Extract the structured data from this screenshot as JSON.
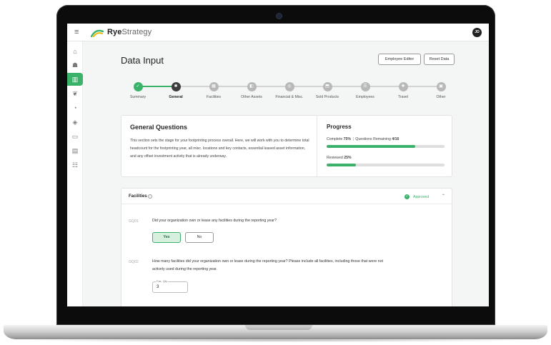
{
  "app": {
    "brand_bold": "Rye",
    "brand_light": "Strategy",
    "user_initials": "JD"
  },
  "header": {
    "title": "Data Input",
    "buttons": [
      "Employee Editor",
      "Reset Data"
    ]
  },
  "sidebar": {
    "items": [
      {
        "icon": "home-icon",
        "glyph": "⌂",
        "active": false
      },
      {
        "icon": "user-icon",
        "glyph": "☗",
        "active": false
      },
      {
        "icon": "bar-chart-icon",
        "glyph": "▥",
        "active": true
      },
      {
        "icon": "leaf-icon",
        "glyph": "❦",
        "active": false
      },
      {
        "icon": "pie-chart-icon",
        "glyph": "◔",
        "active": false
      },
      {
        "icon": "layers-icon",
        "glyph": "◈",
        "active": false
      },
      {
        "icon": "folder-icon",
        "glyph": "▭",
        "active": false
      },
      {
        "icon": "document-icon",
        "glyph": "▤",
        "active": false
      },
      {
        "icon": "checklist-icon",
        "glyph": "☷",
        "active": false
      }
    ]
  },
  "stepper": {
    "steps": [
      {
        "label": "Summary",
        "state": "done",
        "icon": "summary-icon",
        "glyph": "✓"
      },
      {
        "label": "General",
        "state": "current",
        "icon": "general-icon",
        "glyph": "✱"
      },
      {
        "label": "Facilities",
        "state": "pending",
        "icon": "building-icon",
        "glyph": "▦"
      },
      {
        "label": "Other Assets",
        "state": "pending",
        "icon": "assets-icon",
        "glyph": "◧"
      },
      {
        "label": "Financial & Misc.",
        "state": "pending",
        "icon": "finance-icon",
        "glyph": "◎"
      },
      {
        "label": "Sold Products",
        "state": "pending",
        "icon": "product-icon",
        "glyph": "⬒"
      },
      {
        "label": "Employees",
        "state": "pending",
        "icon": "employees-icon",
        "glyph": "☰"
      },
      {
        "label": "Travel",
        "state": "pending",
        "icon": "travel-icon",
        "glyph": "✚"
      },
      {
        "label": "Other",
        "state": "pending",
        "icon": "other-icon",
        "glyph": "▣"
      }
    ]
  },
  "general_questions": {
    "title": "General Questions",
    "description": "This section sets the stage for your footprinting process overall. Here, we will work with you to determine total headcount for the footprinting year, all misc. locations and key contacts, essential leased asset information, and any offset investment activity that is already underway."
  },
  "progress": {
    "title": "Progress",
    "complete_label": "Complete",
    "complete_value": "75%",
    "complete_fraction": 0.75,
    "remaining_label": "Questions Remaining",
    "remaining_value": "4/16",
    "reviewed_label": "Reviewed",
    "reviewed_value": "25%",
    "reviewed_fraction": 0.25
  },
  "facilities": {
    "title": "Facilities",
    "status": "Approved",
    "questions": [
      {
        "code": "GQ01",
        "text": "Did your organization own or lease any facilities during the reporting year?",
        "options": [
          "Yes",
          "No"
        ],
        "selected": "Yes"
      },
      {
        "code": "GQ02",
        "text": "How many facilities did your organization own or lease during the reporting year? Please include all facilities, including those that were not actively used during the reporting year.",
        "field_label": "Fac. Qty",
        "field_value": "3"
      }
    ]
  },
  "colors": {
    "accent": "#3bb26a",
    "logo_green": "#3bb26a",
    "logo_yellow": "#f2b705"
  }
}
